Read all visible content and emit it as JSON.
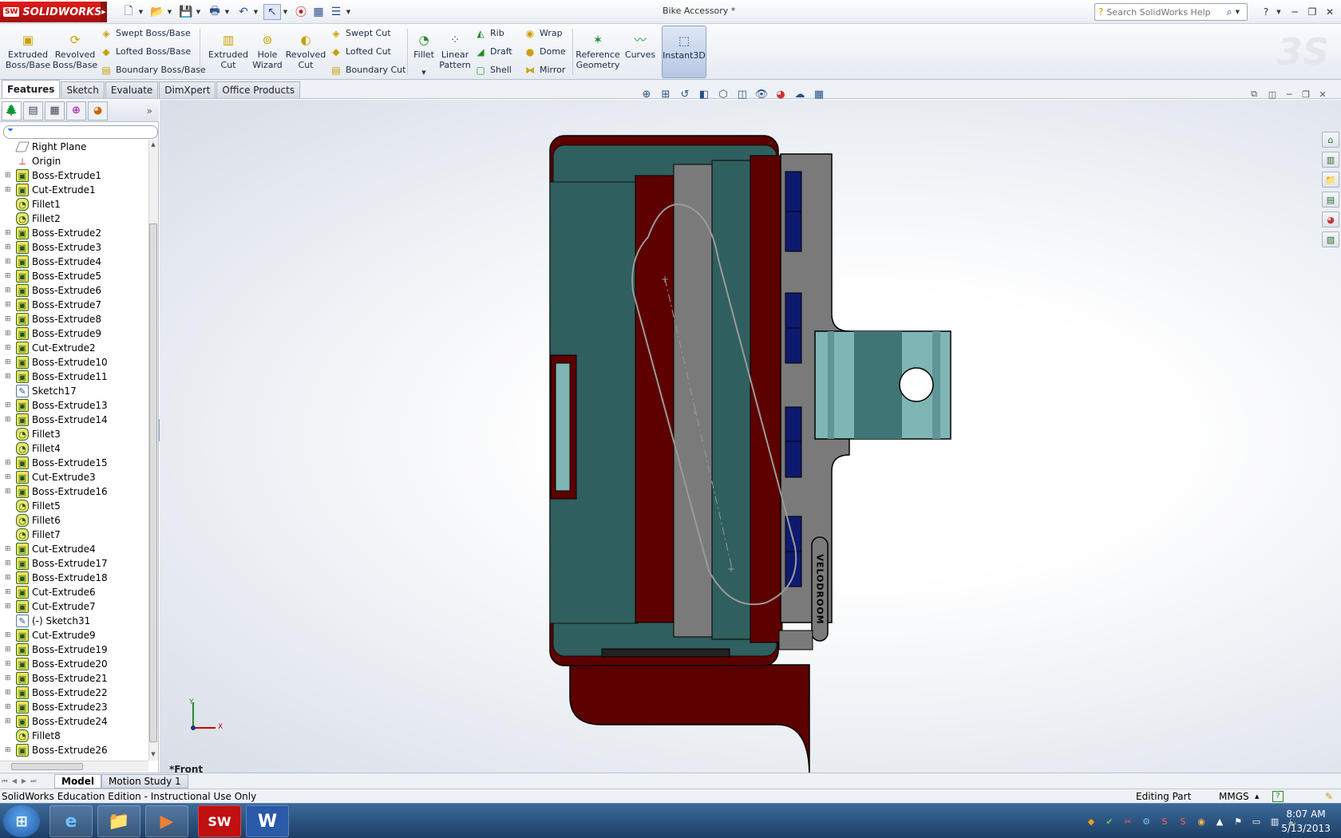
{
  "app": {
    "brand": "SOLIDWORKS",
    "document_title": "Bike Accessory *",
    "search_placeholder": "Search SolidWorks Help",
    "accent": "#cc1111"
  },
  "command_manager": {
    "big_buttons": [
      {
        "label": "Extruded Boss/Base",
        "line1": "Extruded",
        "line2": "Boss/Base"
      },
      {
        "label": "Revolved Boss/Base",
        "line1": "Revolved",
        "line2": "Boss/Base"
      },
      {
        "label": "Extruded Cut",
        "line1": "Extruded",
        "line2": "Cut"
      },
      {
        "label": "Hole Wizard",
        "line1": "Hole",
        "line2": "Wizard"
      },
      {
        "label": "Revolved Cut",
        "line1": "Revolved",
        "line2": "Cut"
      },
      {
        "label": "Fillet"
      },
      {
        "label": "Linear Pattern",
        "line1": "Linear",
        "line2": "Pattern"
      },
      {
        "label": "Reference Geometry",
        "line1": "Reference",
        "line2": "Geometry"
      },
      {
        "label": "Curves"
      },
      {
        "label": "Instant3D"
      }
    ],
    "small_buttons": {
      "swept_boss": "Swept Boss/Base",
      "lofted_boss": "Lofted Boss/Base",
      "boundary_boss": "Boundary Boss/Base",
      "swept_cut": "Swept Cut",
      "lofted_cut": "Lofted Cut",
      "boundary_cut": "Boundary Cut",
      "rib": "Rib",
      "draft": "Draft",
      "shell": "Shell",
      "wrap": "Wrap",
      "dome": "Dome",
      "mirror": "Mirror"
    }
  },
  "tabs": [
    "Features",
    "Sketch",
    "Evaluate",
    "DimXpert",
    "Office Products"
  ],
  "feature_tree": [
    {
      "label": "Right Plane",
      "type": "plane"
    },
    {
      "label": "Origin",
      "type": "origin"
    },
    {
      "label": "Boss-Extrude1",
      "type": "feature"
    },
    {
      "label": "Cut-Extrude1",
      "type": "feature"
    },
    {
      "label": "Fillet1",
      "type": "fillet"
    },
    {
      "label": "Fillet2",
      "type": "fillet"
    },
    {
      "label": "Boss-Extrude2",
      "type": "feature"
    },
    {
      "label": "Boss-Extrude3",
      "type": "feature"
    },
    {
      "label": "Boss-Extrude4",
      "type": "feature"
    },
    {
      "label": "Boss-Extrude5",
      "type": "feature"
    },
    {
      "label": "Boss-Extrude6",
      "type": "feature"
    },
    {
      "label": "Boss-Extrude7",
      "type": "feature"
    },
    {
      "label": "Boss-Extrude8",
      "type": "feature"
    },
    {
      "label": "Boss-Extrude9",
      "type": "feature"
    },
    {
      "label": "Cut-Extrude2",
      "type": "feature"
    },
    {
      "label": "Boss-Extrude10",
      "type": "feature"
    },
    {
      "label": "Boss-Extrude11",
      "type": "feature"
    },
    {
      "label": "Sketch17",
      "type": "sketch"
    },
    {
      "label": "Boss-Extrude13",
      "type": "feature"
    },
    {
      "label": "Boss-Extrude14",
      "type": "feature"
    },
    {
      "label": "Fillet3",
      "type": "fillet"
    },
    {
      "label": "Fillet4",
      "type": "fillet"
    },
    {
      "label": "Boss-Extrude15",
      "type": "feature"
    },
    {
      "label": "Cut-Extrude3",
      "type": "feature"
    },
    {
      "label": "Boss-Extrude16",
      "type": "feature"
    },
    {
      "label": "Fillet5",
      "type": "fillet"
    },
    {
      "label": "Fillet6",
      "type": "fillet"
    },
    {
      "label": "Fillet7",
      "type": "fillet"
    },
    {
      "label": "Cut-Extrude4",
      "type": "feature"
    },
    {
      "label": "Boss-Extrude17",
      "type": "feature"
    },
    {
      "label": "Boss-Extrude18",
      "type": "feature"
    },
    {
      "label": "Cut-Extrude6",
      "type": "feature"
    },
    {
      "label": "Cut-Extrude7",
      "type": "feature"
    },
    {
      "label": "(-) Sketch31",
      "type": "sketch"
    },
    {
      "label": "Cut-Extrude9",
      "type": "feature"
    },
    {
      "label": "Boss-Extrude19",
      "type": "feature"
    },
    {
      "label": "Boss-Extrude20",
      "type": "feature"
    },
    {
      "label": "Boss-Extrude21",
      "type": "feature"
    },
    {
      "label": "Boss-Extrude22",
      "type": "feature"
    },
    {
      "label": "Boss-Extrude23",
      "type": "feature"
    },
    {
      "label": "Boss-Extrude24",
      "type": "feature"
    },
    {
      "label": "Fillet8",
      "type": "fillet"
    },
    {
      "label": "Boss-Extrude26",
      "type": "feature"
    }
  ],
  "viewport": {
    "view_name": "*Front",
    "model_label": "VELODROOM",
    "axis_x": "X",
    "axis_y": "Y",
    "colors": {
      "dark_red": "#5c0000",
      "teal": "#2f5f5e",
      "gray": "#7a7a7a",
      "navy": "#0d1a6e",
      "light_teal": "#7fb5b4"
    }
  },
  "bottom_tabs": [
    "Model",
    "Motion Study 1"
  ],
  "status_bar": {
    "left": "SolidWorks Education Edition - Instructional Use Only",
    "mode": "Editing Part",
    "units": "MMGS",
    "help": "?"
  },
  "taskbar": {
    "time": "8:07 AM",
    "date": "5/13/2013",
    "apps": [
      "Internet Explorer",
      "Windows Explorer",
      "Media Player",
      "SolidWorks",
      "Word"
    ]
  }
}
